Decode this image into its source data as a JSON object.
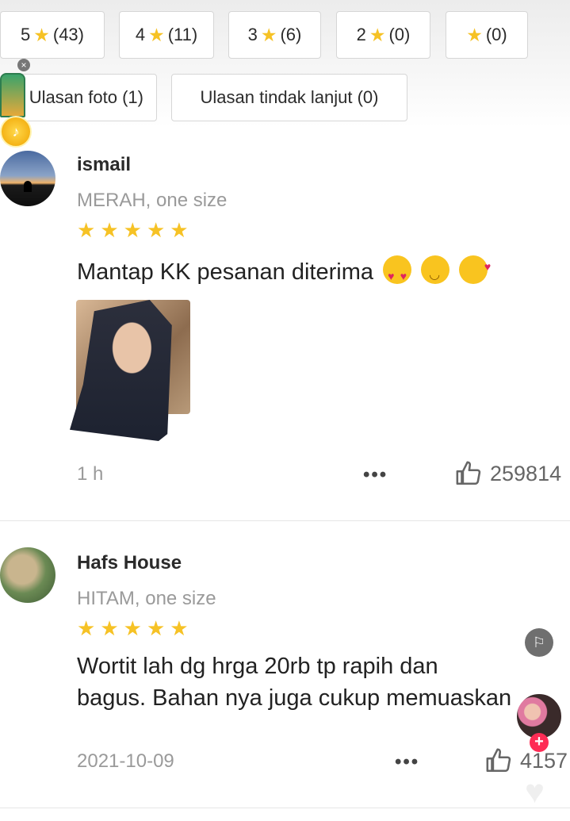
{
  "filters": {
    "rating_chips": [
      {
        "label": "5",
        "count": "(43)"
      },
      {
        "label": "4",
        "count": "(11)"
      },
      {
        "label": "3",
        "count": "(6)"
      },
      {
        "label": "2",
        "count": "(0)"
      },
      {
        "label": "",
        "count": "(0)"
      }
    ],
    "photo_reviews": "Ulasan foto (1)",
    "followup_reviews": "Ulasan tindak lanjut (0)"
  },
  "reviews": [
    {
      "user": "ismail",
      "variant": "MERAH, one size",
      "rating": 5,
      "text": "Mantap KK pesanan diterima",
      "time": "1 h",
      "likes": "259814",
      "more": "•••"
    },
    {
      "user": "Hafs House",
      "variant": "HITAM, one size",
      "rating": 5,
      "text_line1": "Wortit lah dg hrga 20rb tp rapih dan",
      "text_line2": "bagus. Bahan nya juga cukup memuaskan",
      "time": "2021-10-09",
      "likes": "4157",
      "more": "•••"
    }
  ],
  "colors": {
    "star": "#f6c225",
    "follow_plus": "#fe2c55",
    "muted_text": "#9a9a9a"
  },
  "icons": {
    "star": "★",
    "close": "×",
    "report": "⚐",
    "plus": "+",
    "heart": "♥"
  }
}
